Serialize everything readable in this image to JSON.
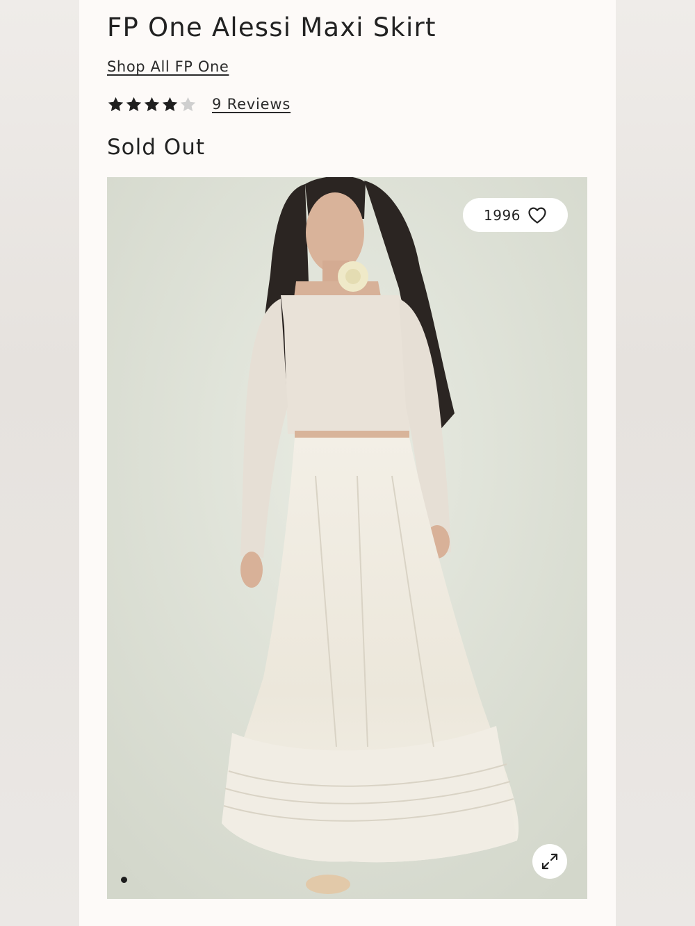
{
  "product": {
    "title": "FP One Alessi Maxi Skirt",
    "brand_link": "Shop All FP One",
    "rating": {
      "value": 4,
      "max": 5,
      "reviews_label": "9 Reviews"
    },
    "status": "Sold Out"
  },
  "gallery": {
    "favorites_count": "1996",
    "favorite_icon": "heart-outline-icon",
    "expand_icon": "expand-arrows-icon",
    "slide_count": 1,
    "active_slide": 1
  },
  "colors": {
    "page_bg": "#fdfaf8",
    "text": "#222222",
    "star_filled": "#1f1f1f",
    "star_empty": "#cfcfcf",
    "photo_bg": "#dfe3d9"
  }
}
